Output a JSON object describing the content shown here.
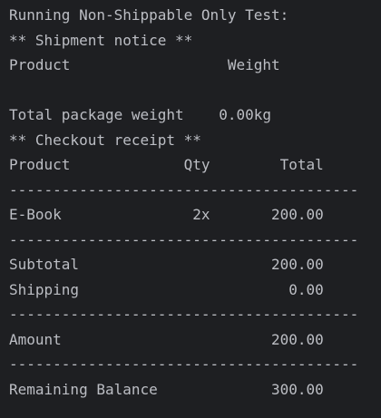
{
  "console": {
    "lines": [
      "Running Non-Shippable Only Test:",
      "** Shipment notice **",
      "Product                  Weight",
      "",
      "Total package weight    0.00kg",
      "** Checkout receipt **",
      "Product             Qty        Total",
      "----------------------------------------",
      "E-Book               2x       200.00",
      "----------------------------------------",
      "Subtotal                      200.00",
      "Shipping                        0.00",
      "----------------------------------------",
      "Amount                        200.00",
      "----------------------------------------",
      "Remaining Balance             300.00"
    ]
  }
}
